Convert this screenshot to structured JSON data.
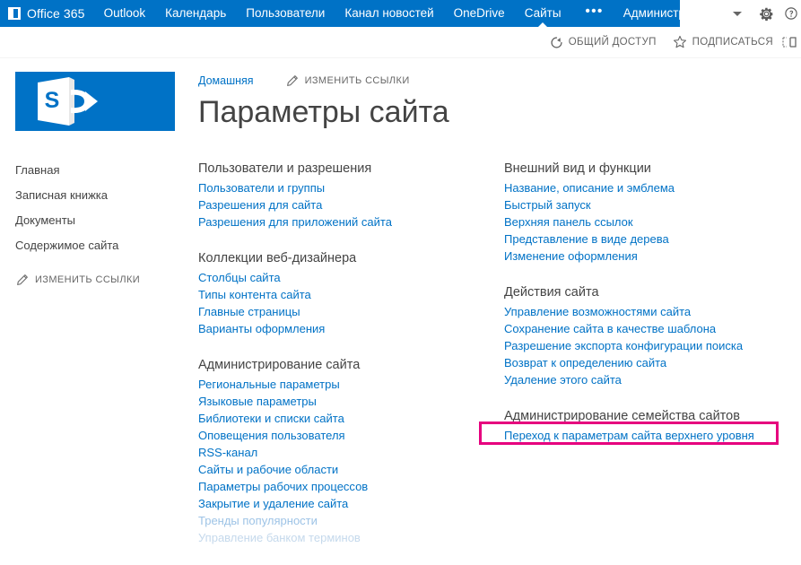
{
  "suite": {
    "brand": "Office 365",
    "brand_icon": "office-tile-icon",
    "nav": [
      {
        "label": "Outlook",
        "active": false
      },
      {
        "label": "Календарь",
        "active": false
      },
      {
        "label": "Пользователи",
        "active": false
      },
      {
        "label": "Канал новостей",
        "active": false
      },
      {
        "label": "OneDrive",
        "active": false
      },
      {
        "label": "Сайты",
        "active": true
      }
    ],
    "ellipsis": "•••",
    "user": "Администратор",
    "user_caret_icon": "caret-down-icon",
    "right_caret_icon": "caret-down-icon",
    "settings_icon": "gear-icon",
    "help_icon": "help-icon",
    "bar_color": "#0072c6"
  },
  "actionbar": {
    "share": {
      "label": "ОБЩИЙ ДОСТУП",
      "icon": "share-icon"
    },
    "follow": {
      "label": "ПОДПИСАТЬСЯ",
      "icon": "star-icon"
    },
    "focus": {
      "icon": "focus-on-content-icon"
    }
  },
  "leftnav": {
    "logo_icon": "sharepoint-logo-icon",
    "logo_color": "#0072c6",
    "items": [
      {
        "label": "Главная"
      },
      {
        "label": "Записная книжка"
      },
      {
        "label": "Документы"
      },
      {
        "label": "Содержимое сайта"
      }
    ],
    "edit_links": {
      "label": "ИЗМЕНИТЬ ССЫЛКИ",
      "icon": "pencil-icon"
    }
  },
  "pagehead": {
    "breadcrumb": "Домашняя",
    "edit_links": {
      "label": "ИЗМЕНИТЬ ССЫЛКИ",
      "icon": "pencil-icon"
    },
    "title": "Параметры сайта"
  },
  "columns": {
    "left": [
      {
        "title": "Пользователи и разрешения",
        "links": [
          {
            "label": "Пользователи и группы",
            "state": "normal"
          },
          {
            "label": "Разрешения для сайта",
            "state": "normal"
          },
          {
            "label": "Разрешения для приложений сайта",
            "state": "normal"
          }
        ]
      },
      {
        "title": "Коллекции веб-дизайнера",
        "links": [
          {
            "label": "Столбцы сайта",
            "state": "normal"
          },
          {
            "label": "Типы контента сайта",
            "state": "normal"
          },
          {
            "label": "Главные страницы",
            "state": "normal"
          },
          {
            "label": "Варианты оформления",
            "state": "normal"
          }
        ]
      },
      {
        "title": "Администрирование сайта",
        "links": [
          {
            "label": "Региональные параметры",
            "state": "normal"
          },
          {
            "label": "Языковые параметры",
            "state": "normal"
          },
          {
            "label": "Библиотеки и списки сайта",
            "state": "normal"
          },
          {
            "label": "Оповещения пользователя",
            "state": "normal"
          },
          {
            "label": "RSS-канал",
            "state": "normal"
          },
          {
            "label": "Сайты и рабочие области",
            "state": "normal"
          },
          {
            "label": "Параметры рабочих процессов",
            "state": "normal"
          },
          {
            "label": "Закрытие и удаление сайта",
            "state": "normal"
          },
          {
            "label": "Тренды популярности",
            "state": "dim"
          },
          {
            "label": "Управление банком терминов",
            "state": "dimmer"
          }
        ]
      }
    ],
    "right": [
      {
        "title": "Внешний вид и функции",
        "links": [
          {
            "label": "Название, описание и эмблема",
            "state": "normal"
          },
          {
            "label": "Быстрый запуск",
            "state": "normal"
          },
          {
            "label": "Верхняя панель ссылок",
            "state": "normal"
          },
          {
            "label": "Представление в виде дерева",
            "state": "normal"
          },
          {
            "label": "Изменение оформления",
            "state": "normal"
          }
        ]
      },
      {
        "title": "Действия сайта",
        "links": [
          {
            "label": "Управление возможностями сайта",
            "state": "normal"
          },
          {
            "label": "Сохранение сайта в качестве шаблона",
            "state": "normal"
          },
          {
            "label": "Разрешение экспорта конфигурации поиска",
            "state": "normal"
          },
          {
            "label": "Возврат к определению сайта",
            "state": "normal"
          },
          {
            "label": "Удаление этого сайта",
            "state": "normal"
          }
        ]
      },
      {
        "title": "Администрирование семейства сайтов",
        "links": [
          {
            "label": "Переход к параметрам сайта верхнего уровня",
            "state": "normal",
            "highlighted": true
          }
        ]
      }
    ]
  },
  "annotation": {
    "highlight_color": "#e6007e",
    "highlight_target": "Переход к параметрам сайта верхнего уровня"
  }
}
